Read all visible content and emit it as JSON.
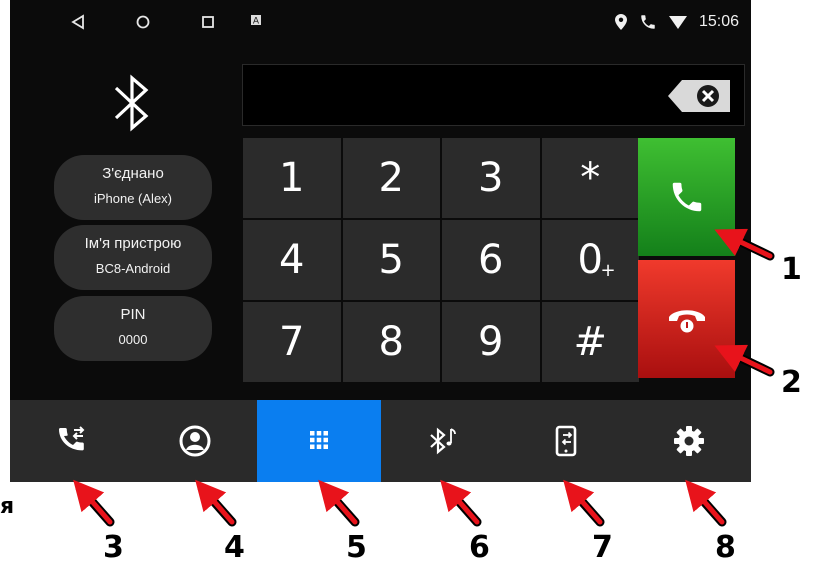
{
  "status_bar": {
    "time": "15:06",
    "icons": [
      "back-icon",
      "home-icon",
      "recents-icon",
      "notification-a-icon",
      "location-icon",
      "phone-icon",
      "wifi-icon"
    ]
  },
  "bluetooth_panel": {
    "connected_label": "З'єднано",
    "connected_value": "iPhone (Alex)",
    "device_name_label": "Ім'я пристрою",
    "device_name_value": "BC8-Android",
    "pin_label": "PIN",
    "pin_value": "0000"
  },
  "number_display": {
    "value": ""
  },
  "keypad": {
    "keys": [
      "1",
      "2",
      "3",
      "*",
      "4",
      "5",
      "6",
      "0",
      "7",
      "8",
      "9",
      "#"
    ],
    "zero_secondary": "+"
  },
  "bottom_nav": {
    "tabs": [
      {
        "icon": "call-log-icon",
        "active": false
      },
      {
        "icon": "contacts-icon",
        "active": false
      },
      {
        "icon": "dialpad-icon",
        "active": true
      },
      {
        "icon": "bluetooth-music-icon",
        "active": false
      },
      {
        "icon": "phone-transfer-icon",
        "active": false
      },
      {
        "icon": "settings-icon",
        "active": false
      }
    ]
  },
  "annotations": {
    "callouts": [
      "1",
      "2",
      "3",
      "4",
      "5",
      "6",
      "7",
      "8"
    ],
    "stray_text": "я"
  },
  "colors": {
    "active_tab": "#0a7ef0",
    "call_green": "#2aa52a",
    "hangup_red": "#d41f1f",
    "arrow_red": "#e8131b"
  }
}
